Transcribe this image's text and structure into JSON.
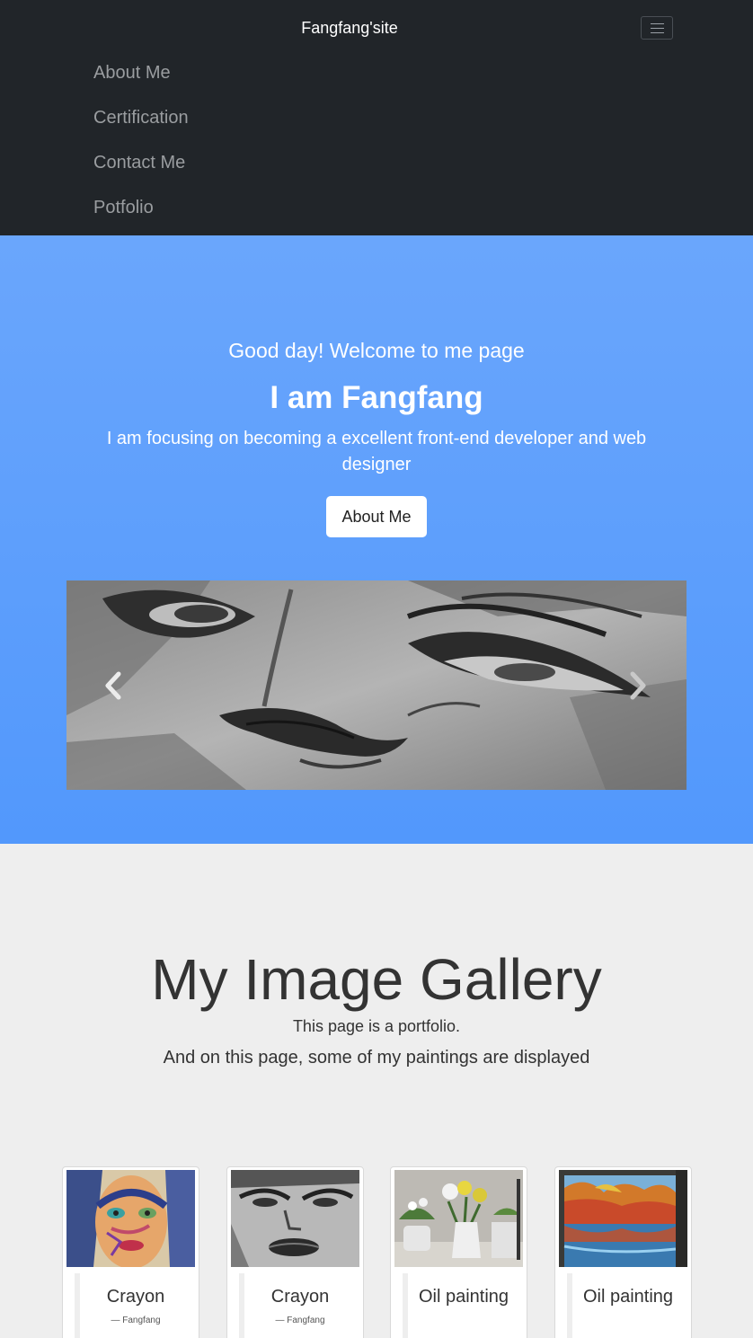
{
  "navbar": {
    "brand": "Fangfang'site",
    "items": [
      {
        "label": "About Me"
      },
      {
        "label": "Certification"
      },
      {
        "label": "Contact Me"
      },
      {
        "label": "Potfolio"
      }
    ]
  },
  "hero": {
    "greeting": "Good day! Welcome to me page",
    "title": "I am Fangfang",
    "subtitle": "I am focusing on becoming a excellent front-end developer and web designer",
    "button_label": "About Me"
  },
  "gallery": {
    "title": "My Image Gallery",
    "line1": "This page is a portfolio.",
    "line2": "And on this page, some of my paintings are displayed",
    "cards": [
      {
        "caption": "Crayon",
        "author": "— Fangfang"
      },
      {
        "caption": "Crayon",
        "author": "— Fangfang"
      },
      {
        "caption": "Oil painting",
        "author": ""
      },
      {
        "caption": "Oil painting",
        "author": ""
      }
    ]
  },
  "colors": {
    "navbar_bg": "#212529",
    "hero_top": "#6aa6fc",
    "hero_bottom": "#5298fc",
    "page_bg": "#eeeeee"
  },
  "icons": [
    "menu-icon",
    "chevron-left-icon",
    "chevron-right-icon"
  ]
}
